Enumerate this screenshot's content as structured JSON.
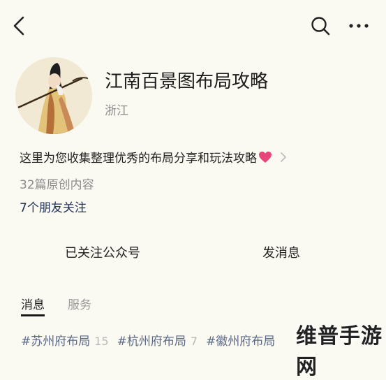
{
  "account": {
    "name": "江南百景图布局攻略",
    "region": "浙江",
    "description": "这里为您收集整理优秀的布局分享和玩法攻略",
    "articles": "32篇原创内容",
    "friends_following": "7个朋友关注"
  },
  "actions": {
    "followed": "已关注公众号",
    "send_message": "发消息"
  },
  "tabs": [
    {
      "label": "消息",
      "active": true
    },
    {
      "label": "服务",
      "active": false
    }
  ],
  "tags": [
    {
      "name": "#苏州府布局",
      "count": "15"
    },
    {
      "name": "#杭州府布局",
      "count": "7"
    },
    {
      "name": "#徽州府布局",
      "count": ""
    }
  ],
  "watermark": "维普手游网",
  "icons": [
    "back-icon",
    "search-icon",
    "more-icon",
    "heart-icon",
    "chevron-right-icon"
  ],
  "colors": {
    "background": "#fbfaf2",
    "heart": "#e8457a",
    "link": "#20305a",
    "tag": "#5c6a88"
  }
}
